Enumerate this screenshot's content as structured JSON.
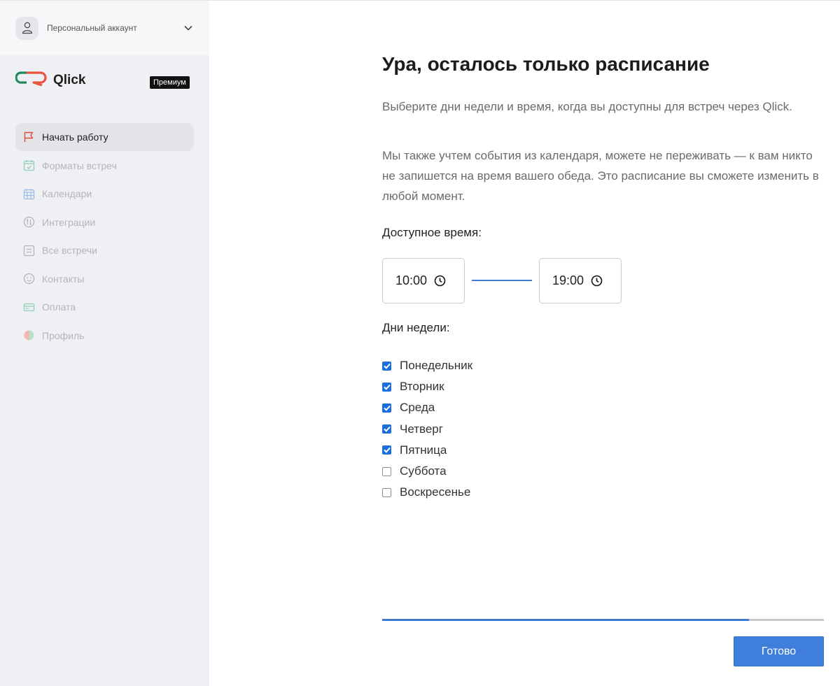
{
  "sidebar": {
    "account_label": "Персональный аккаунт",
    "logo_text": "Qlick",
    "badge": "Премиум",
    "items": [
      {
        "label": "Начать работу",
        "icon": "flag-icon",
        "active": true
      },
      {
        "label": "Форматы встреч",
        "icon": "calendar-check-icon",
        "active": false
      },
      {
        "label": "Календари",
        "icon": "calendar-grid-icon",
        "active": false
      },
      {
        "label": "Интеграции",
        "icon": "integrations-icon",
        "active": false
      },
      {
        "label": "Все встречи",
        "icon": "list-icon",
        "active": false
      },
      {
        "label": "Контакты",
        "icon": "smile-icon",
        "active": false
      },
      {
        "label": "Оплата",
        "icon": "card-icon",
        "active": false
      },
      {
        "label": "Профиль",
        "icon": "profile-icon",
        "active": false
      }
    ]
  },
  "main": {
    "title": "Ура, осталось только расписание",
    "paragraph1": "Выберите дни недели и время, когда вы доступны для встреч через Qlick.",
    "paragraph2": "Мы также учтем события из календаря, можете не переживать — к вам никто не запишется на время вашего обеда. Это расписание вы сможете изменить в любой момент.",
    "time_label": "Доступное время:",
    "time_start": "10:00",
    "time_end": "19:00",
    "days_label": "Дни недели:",
    "days": [
      {
        "label": "Понедельник",
        "checked": true
      },
      {
        "label": "Вторник",
        "checked": true
      },
      {
        "label": "Среда",
        "checked": true
      },
      {
        "label": "Четверг",
        "checked": true
      },
      {
        "label": "Пятница",
        "checked": true
      },
      {
        "label": "Суббота",
        "checked": false
      },
      {
        "label": "Воскресенье",
        "checked": false
      }
    ],
    "progress_fraction": 0.83,
    "done_label": "Готово"
  },
  "colors": {
    "accent": "#3d7bd2",
    "button": "#3f7fdb",
    "checkbox": "#1a6fdc",
    "brand_red": "#e8553f",
    "brand_green": "#1f8a5c",
    "sidebar_bg": "#eff0f3"
  }
}
